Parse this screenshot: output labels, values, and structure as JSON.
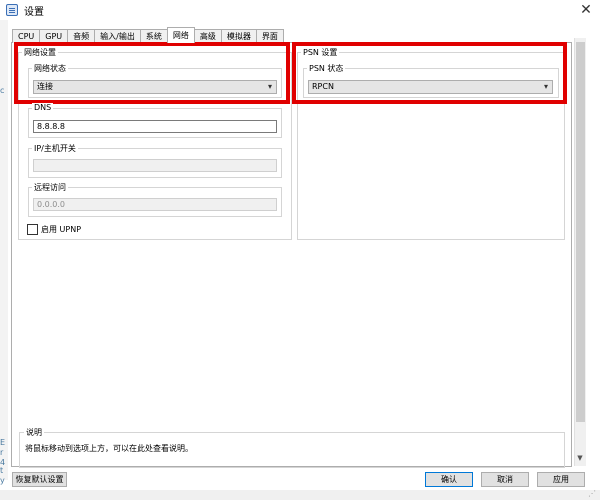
{
  "window": {
    "title": "设置",
    "close_glyph": "✕"
  },
  "tabs": [
    "CPU",
    "GPU",
    "音频",
    "输入/输出",
    "系统",
    "网络",
    "高级",
    "模拟器",
    "界面"
  ],
  "active_tab": "网络",
  "network_settings": {
    "title": "网络设置",
    "status_label": "网络状态",
    "status_value": "连接",
    "dns_label": "DNS",
    "dns_value": "8.8.8.8",
    "ip_label": "IP/主机开关",
    "ip_value": "",
    "remote_label": "远程访问",
    "remote_value": "0.0.0.0",
    "upnp_label": "启用 UPNP",
    "upnp_checked": false
  },
  "psn_settings": {
    "title": "PSN 设置",
    "status_label": "PSN 状态",
    "status_value": "RPCN"
  },
  "description": {
    "title": "说明",
    "text": "将鼠标移动到选项上方，可以在此处查看说明。"
  },
  "buttons": {
    "defaults": "恢复默认设置",
    "ok": "确认",
    "cancel": "取消",
    "apply": "应用"
  },
  "edge_chars": [
    "c",
    "E",
    "r",
    "4",
    "t",
    "y"
  ],
  "colors": {
    "highlight": "#e00000",
    "default_button_border": "#0078d7"
  },
  "icons": {
    "dropdown": "▾",
    "scroll_down": "▼",
    "grip": "⋰"
  }
}
